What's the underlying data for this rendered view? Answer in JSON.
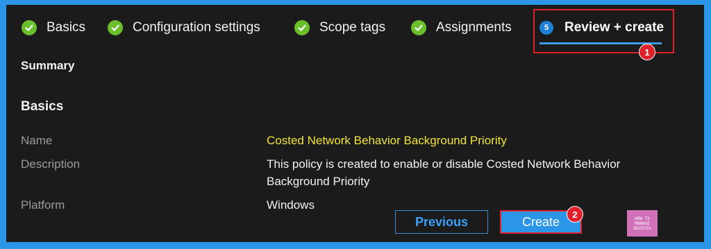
{
  "wizard": {
    "steps": [
      {
        "label": "Basics",
        "state": "complete"
      },
      {
        "label": "Configuration settings",
        "state": "complete"
      },
      {
        "label": "Scope tags",
        "state": "complete"
      },
      {
        "label": "Assignments",
        "state": "complete"
      },
      {
        "label": "Review + create",
        "state": "active",
        "number": "5"
      }
    ]
  },
  "annotations": {
    "badge1": "1",
    "badge2": "2"
  },
  "summary": {
    "title": "Summary",
    "section": "Basics",
    "fields": [
      {
        "label": "Name",
        "value": "Costed Network Behavior Background Priority"
      },
      {
        "label": "Description",
        "value_line1": "This policy is created to enable or disable Costed Network Behavior",
        "value_line2": "Background Priority"
      },
      {
        "label": "Platform",
        "value": "Windows"
      }
    ]
  },
  "buttons": {
    "previous": "Previous",
    "create": "Create"
  },
  "logo": {
    "line1": "HOW TO",
    "line2": "MANAGE",
    "line3": "DEVICES"
  },
  "colors": {
    "accent": "#2b96e8",
    "success": "#6cbf2c",
    "highlight": "#e0202a",
    "name_value": "#f1e43a"
  }
}
